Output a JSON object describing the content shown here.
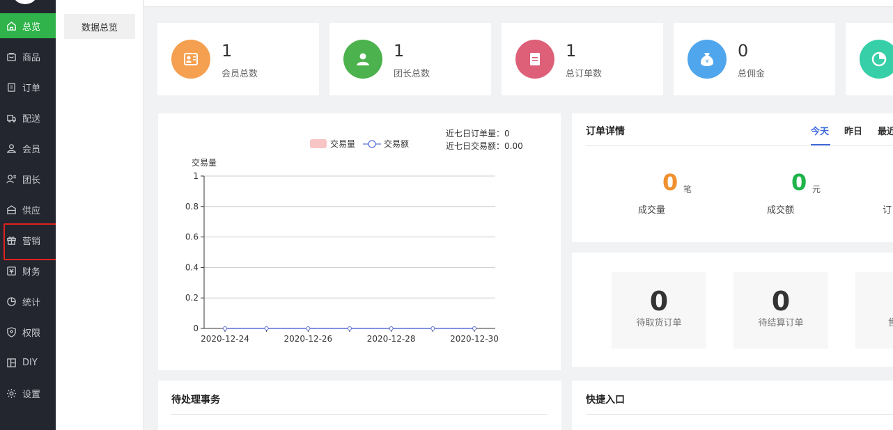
{
  "colors": {
    "sidebar_bg": "#23252f",
    "active": "#2fb34a",
    "highlight": "#e0231f",
    "tab_active": "#3f6ad8",
    "orange": "#f0902f",
    "green": "#1fb44a",
    "legend_bar": "#f8c5c5",
    "line": "#5b6fd6"
  },
  "sidebar": {
    "items": [
      {
        "label": "总览",
        "icon": "home-icon"
      },
      {
        "label": "商品",
        "icon": "goods-icon"
      },
      {
        "label": "订单",
        "icon": "order-icon"
      },
      {
        "label": "配送",
        "icon": "delivery-icon"
      },
      {
        "label": "会员",
        "icon": "member-icon"
      },
      {
        "label": "团长",
        "icon": "leader-icon"
      },
      {
        "label": "供应",
        "icon": "supply-icon"
      },
      {
        "label": "营销",
        "icon": "gift-icon"
      },
      {
        "label": "财务",
        "icon": "finance-icon"
      },
      {
        "label": "统计",
        "icon": "stats-icon"
      },
      {
        "label": "权限",
        "icon": "shield-icon"
      },
      {
        "label": "DIY",
        "icon": "layout-icon"
      },
      {
        "label": "设置",
        "icon": "gear-icon"
      }
    ]
  },
  "subnav": {
    "label": "数据总览"
  },
  "stats": [
    {
      "value": "1",
      "label": "会员总数",
      "icon": "member-card-icon",
      "color": "#f4a050"
    },
    {
      "value": "1",
      "label": "团长总数",
      "icon": "leader-group-icon",
      "color": "#4cb24d"
    },
    {
      "value": "1",
      "label": "总订单数",
      "icon": "order-doc-icon",
      "color": "#dd6078"
    },
    {
      "value": "0",
      "label": "总佣金",
      "icon": "money-bag-icon",
      "color": "#4fa6ec"
    },
    {
      "value": "",
      "label": "",
      "icon": "pie-chart-icon",
      "color": "#36cfa8"
    }
  ],
  "chart_panel": {
    "legend": [
      "交易量",
      "交易额"
    ],
    "summary_orders": "近七日订单量：0",
    "summary_amount": "近七日交易额：0.00"
  },
  "chart_data": {
    "type": "line",
    "ylabel": "交易量",
    "ylim": [
      0,
      1
    ],
    "yticks": [
      "1",
      "0.8",
      "0.6",
      "0.4",
      "0.2",
      "0"
    ],
    "x": [
      "2020-12-24",
      "2020-12-25",
      "2020-12-26",
      "2020-12-27",
      "2020-12-28",
      "2020-12-29",
      "2020-12-30"
    ],
    "xtick_labels": [
      "2020-12-24",
      "2020-12-26",
      "2020-12-28",
      "2020-12-30"
    ],
    "series": [
      {
        "name": "交易量",
        "values": [
          0,
          0,
          0,
          0,
          0,
          0,
          0
        ]
      },
      {
        "name": "交易额",
        "values": [
          0,
          0,
          0,
          0,
          0,
          0,
          0
        ]
      }
    ],
    "grid": true,
    "legend_position": "top"
  },
  "order_detail": {
    "title": "订单详情",
    "tabs": [
      "今天",
      "昨日",
      "最近"
    ],
    "metrics": [
      {
        "value": "0",
        "unit": "笔",
        "label": "成交量"
      },
      {
        "value": "0",
        "unit": "元",
        "label": "成交额"
      },
      {
        "label": "订"
      }
    ]
  },
  "pending_boxes": [
    {
      "value": "0",
      "label": "待取货订单"
    },
    {
      "value": "0",
      "label": "待结算订单"
    },
    {
      "label": "售"
    }
  ],
  "todo": {
    "title": "待处理事务"
  },
  "shortcut": {
    "title": "快捷入口"
  }
}
